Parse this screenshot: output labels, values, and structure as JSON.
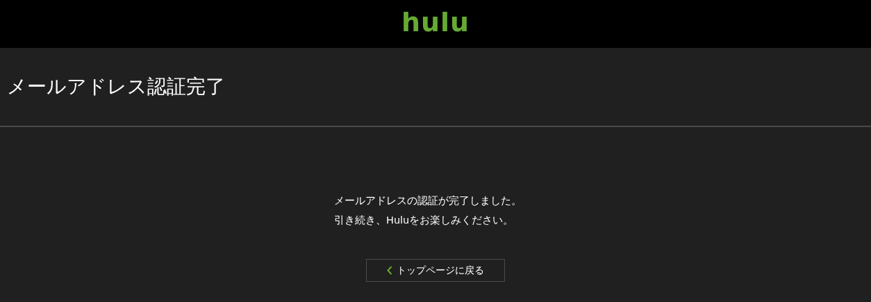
{
  "header": {
    "logo": "hulu"
  },
  "page_title": "メールアドレス認証完了",
  "message": [
    "メールアドレスの認証が完了しました。",
    "引き続き、Huluをお楽しみください。"
  ],
  "back_button": {
    "label": "トップページに戻る"
  }
}
